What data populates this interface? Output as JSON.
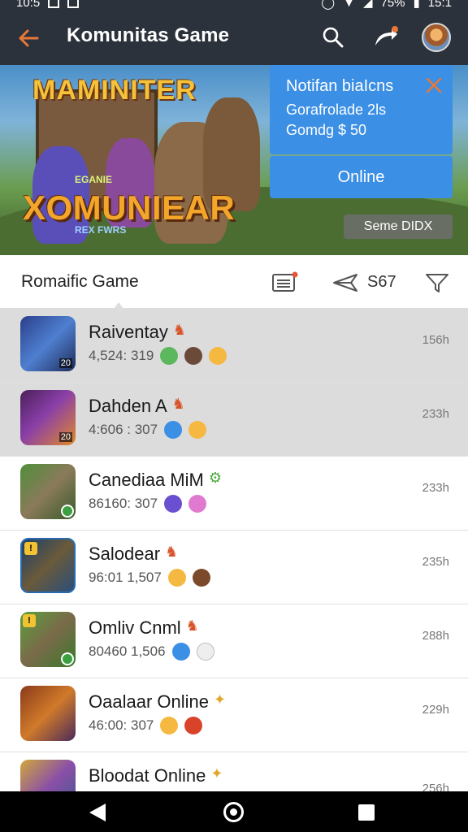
{
  "status_bar": {
    "time": "10:5",
    "battery": "75%",
    "clock": "15:1"
  },
  "app_bar": {
    "title": "Komunitas Game"
  },
  "banner": {
    "logo_top": "MAMINITER",
    "logo_main": "XOMUNIEAR",
    "logo_small": "EGANIE",
    "logo_tiny": "REX FWRS",
    "notification": {
      "title": "Notifan biaIcns",
      "line1": "Gorafrolade 2ls",
      "line2": "Gomdg $ 50"
    },
    "online_button": "Online",
    "secondary_button": "Seme DIDX"
  },
  "filter_bar": {
    "title": "Romaific Game",
    "count": "S67"
  },
  "games": [
    {
      "name": "Raiventay",
      "meta": "4,524: 319",
      "time": "156h",
      "highlight": true,
      "badge": "20"
    },
    {
      "name": "Dahden A",
      "meta": "4:606 : 307",
      "time": "233h",
      "highlight": true,
      "badge": "20"
    },
    {
      "name": "Canediaa MiM",
      "meta": "86160: 307",
      "time": "233h",
      "highlight": false
    },
    {
      "name": "Salodear",
      "meta": "96:01 1,507",
      "time": "235h",
      "highlight": false
    },
    {
      "name": "Omliv Cnml",
      "meta": "80460 1,506",
      "time": "288h",
      "highlight": false
    },
    {
      "name": "Oaalaar Online",
      "meta": "46:00: 307",
      "time": "229h",
      "highlight": false
    },
    {
      "name": "Bloodat Online",
      "meta": "",
      "time": "256h",
      "highlight": false
    }
  ],
  "colors": {
    "app_bar": "#2b323b",
    "accent_orange": "#e8773a",
    "primary_blue": "#3b8fe4",
    "highlight_row": "#dcdcdc"
  }
}
